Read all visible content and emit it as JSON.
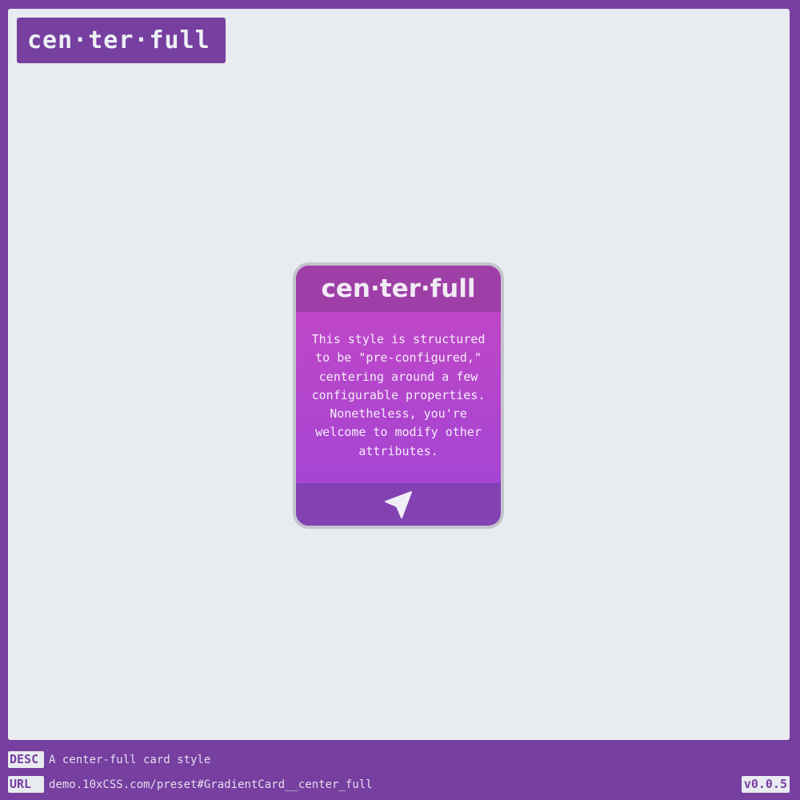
{
  "title_badge": "cen·ter·full",
  "card": {
    "title": "cen·ter·full",
    "body": "This style is structured to be \"pre-configured,\" centering around a few configurable properties. Nonetheless, you're welcome to modify other attributes.",
    "footer_icon": "send-arrow-icon"
  },
  "footer": {
    "desc_tag": "DESC",
    "desc_text": "A center-full card style",
    "url_tag": "URL",
    "url_text": "demo.10xCSS.com/preset#GradientCard__center_full",
    "version": "v0.0.5"
  },
  "colors": {
    "frame": "#763fa0",
    "stage": "#e8ebf0",
    "card_header": "#9e3fa8",
    "card_gradient_top": "#c647c4",
    "card_gradient_bottom": "#9f44d6",
    "card_footer": "#8242b2"
  }
}
